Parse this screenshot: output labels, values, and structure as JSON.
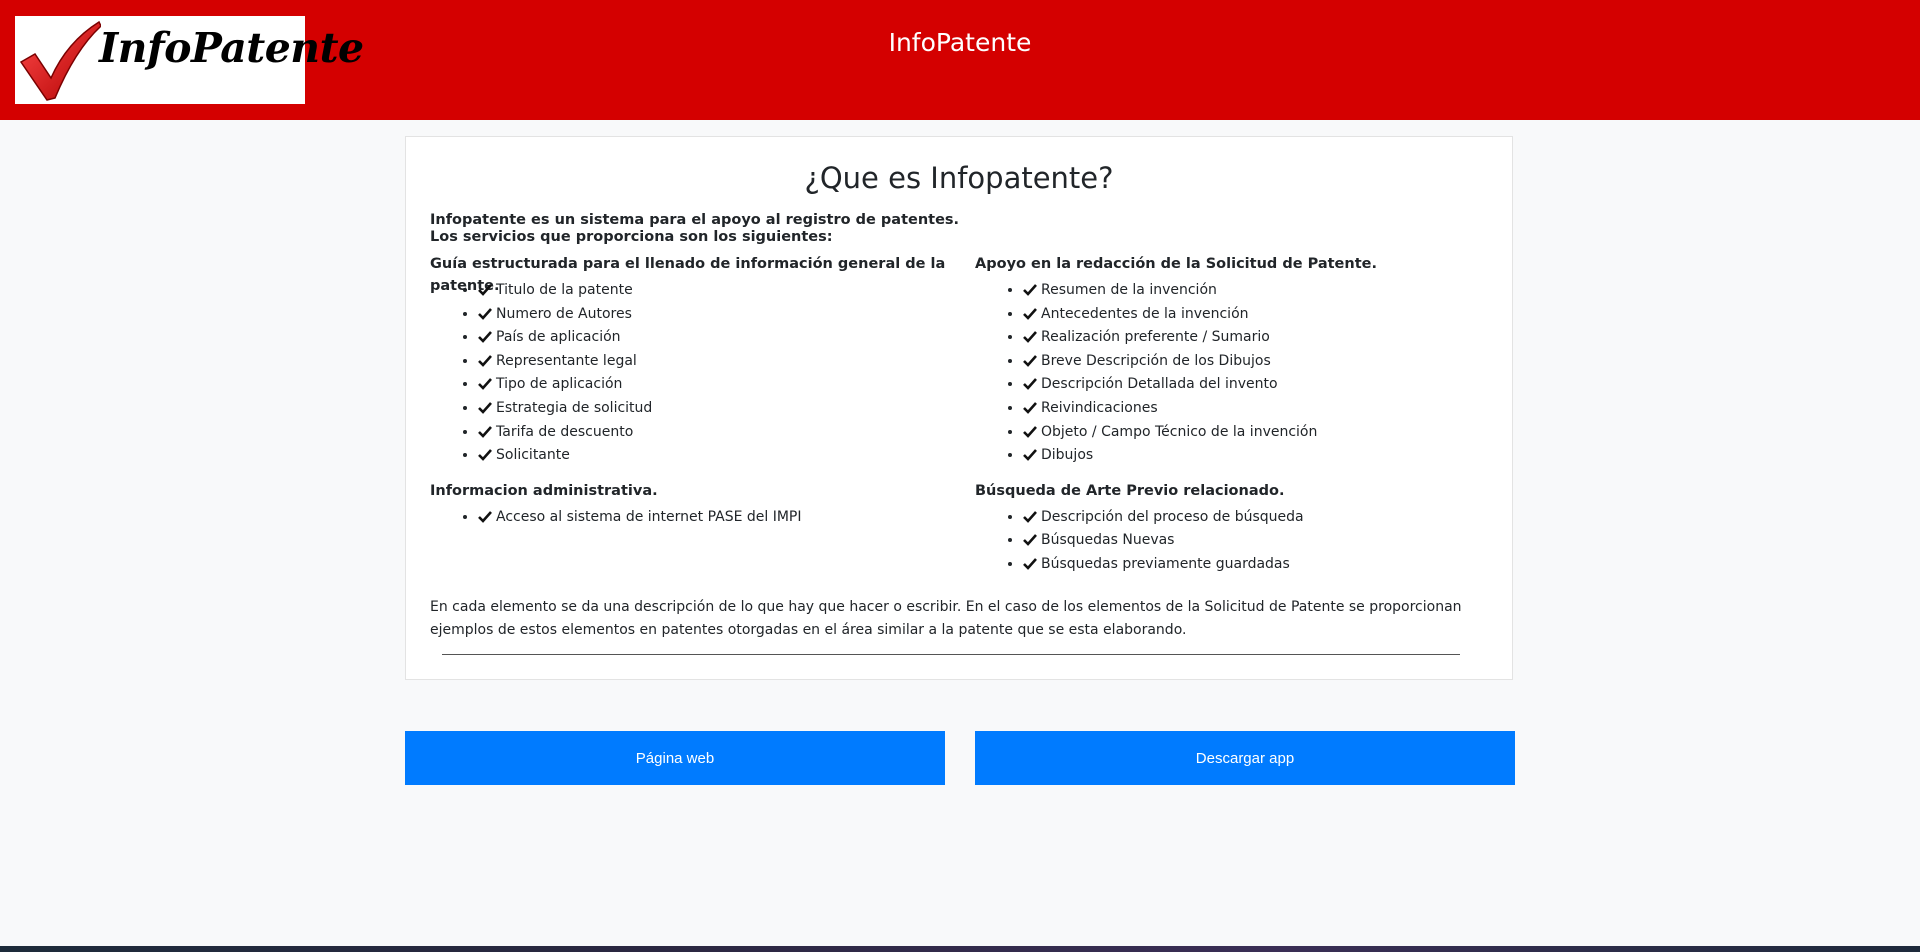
{
  "header": {
    "logo_text": "InfoPatente",
    "title": "InfoPatente",
    "background_color": "#d40000"
  },
  "card": {
    "title": "¿Que es Infopatente?",
    "intro_line1": "Infopatente es un sistema para el apoyo al registro de patentes.",
    "intro_line2": "Los servicios que proporciona son los siguientes:",
    "left_sections": [
      {
        "title": "Guía estructurada para el llenado de información general de la patente.",
        "items": [
          "Titulo de la patente",
          "Numero de Autores",
          "País de aplicación",
          "Representante legal",
          "Tipo de aplicación",
          "Estrategia de solicitud",
          "Tarifa de descuento",
          "Solicitante"
        ]
      },
      {
        "title": "Informacion administrativa.",
        "items": [
          "Acceso al sistema de internet PASE del IMPI"
        ]
      }
    ],
    "right_sections": [
      {
        "title": "Apoyo en la redacción de la Solicitud de Patente.",
        "items": [
          "Resumen de la invención",
          "Antecedentes de la invención",
          "Realización preferente / Sumario",
          "Breve Descripción de los Dibujos",
          "Descripción Detallada del invento",
          "Reivindicaciones",
          "Objeto / Campo Técnico de la invención",
          "Dibujos"
        ]
      },
      {
        "title": "Búsqueda de Arte Previo relacionado.",
        "items": [
          "Descripción del proceso de búsqueda",
          "Búsquedas Nuevas",
          "Búsquedas previamente guardadas"
        ]
      }
    ],
    "footer_text": "En cada elemento se da una descripción de lo que hay que hacer o escribir. En el caso de los elementos de la Solicitud de Patente se proporcionan ejemplos de estos elementos en patentes otorgadas en el área similar a la patente que se esta elaborando."
  },
  "buttons": {
    "web_label": "Página web",
    "app_label": "Descargar app",
    "color": "#007bff"
  },
  "icons": {
    "list_item": "check-icon",
    "logo_mark": "checkmark-logo-icon"
  }
}
